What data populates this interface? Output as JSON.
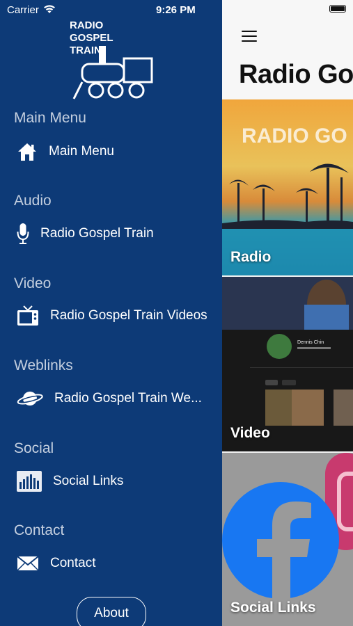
{
  "status": {
    "carrier": "Carrier",
    "time": "9:26 PM"
  },
  "logo": {
    "line1": "RADIO",
    "line2": "GOSPEL",
    "line3": "TRAIN"
  },
  "main": {
    "title": "Radio Go"
  },
  "cards": [
    {
      "label": "Radio",
      "banner": "RADIO GO"
    },
    {
      "label": "Video",
      "channel": "Dennis Chin"
    },
    {
      "label": "Social Links"
    }
  ],
  "menu": [
    {
      "section": "Main Menu",
      "item": "Main Menu",
      "icon": "home-icon"
    },
    {
      "section": "Audio",
      "item": "Radio Gospel Train",
      "icon": "microphone-icon"
    },
    {
      "section": "Video",
      "item": "Radio Gospel Train Videos",
      "icon": "tv-icon"
    },
    {
      "section": "Weblinks",
      "item": "Radio Gospel Train We...",
      "icon": "planet-icon"
    },
    {
      "section": "Social",
      "item": "Social Links",
      "icon": "bar-chart-icon"
    },
    {
      "section": "Contact",
      "item": "Contact",
      "icon": "mail-icon"
    }
  ],
  "about_label": "About",
  "colors": {
    "drawer": "#0d3a77",
    "section_text": "#c4cfdf"
  }
}
